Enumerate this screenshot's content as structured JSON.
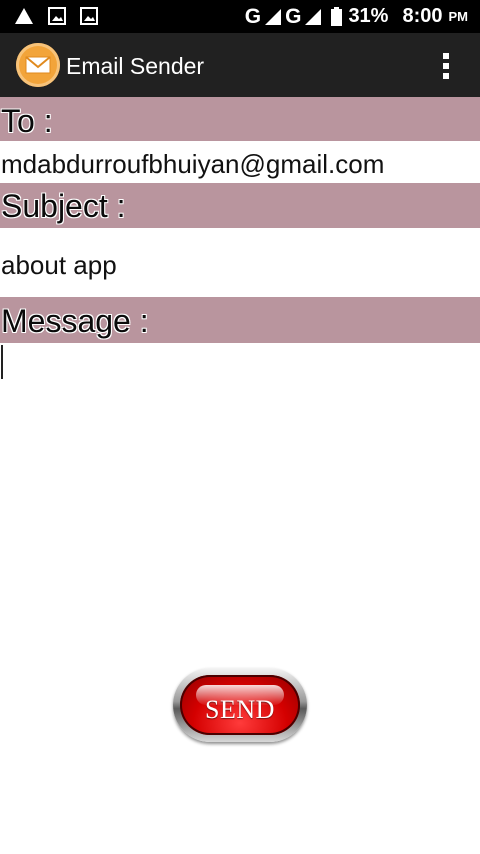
{
  "status_bar": {
    "network_1": "G",
    "network_2": "G",
    "battery": "31%",
    "time": "8:00",
    "ampm": "PM",
    "icons": [
      "warning-icon",
      "image-icon",
      "image-icon",
      "signal-icon",
      "signal-icon",
      "battery-icon"
    ]
  },
  "app_bar": {
    "title": "Email Sender",
    "icon": "email-envelope-icon",
    "menu_icon": "overflow-menu-icon"
  },
  "form": {
    "to_label": "To :",
    "to_value": "mdabdurroufbhuiyan@gmail.com",
    "subject_label": "Subject :",
    "subject_value": "about app",
    "message_label": "Message :",
    "message_value": ""
  },
  "send_button": {
    "label": "SEND"
  },
  "colors": {
    "status_bar": "#000000",
    "app_bar": "#212121",
    "label_band": "#b9959e",
    "send_red": "#d40000",
    "app_icon": "#f2a43a"
  }
}
